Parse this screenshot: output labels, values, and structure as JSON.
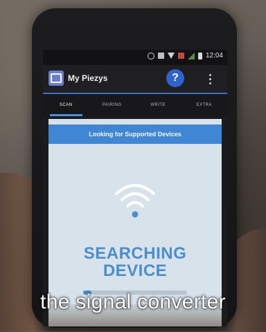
{
  "status_bar": {
    "time": "12:04",
    "icons": [
      "alarm-icon",
      "notification-icon",
      "wifi-icon",
      "sim-icon",
      "signal-icon",
      "battery-icon"
    ]
  },
  "app_bar": {
    "title": "My Piezys",
    "help_label": "?"
  },
  "tabs": [
    {
      "label": "SCAN",
      "active": true
    },
    {
      "label": "PAIRING",
      "active": false
    },
    {
      "label": "WRITE",
      "active": false
    },
    {
      "label": "EXTRA",
      "active": false
    }
  ],
  "content": {
    "header": "Looking for Supported Devices",
    "status_line1": "SEARCHING",
    "status_line2": "DEVICE",
    "progress": 0.08
  },
  "caption": "the signal converter",
  "colors": {
    "accent": "#3f86d4",
    "searching_text": "#4a8ed0",
    "help_button": "#2f63c9"
  }
}
